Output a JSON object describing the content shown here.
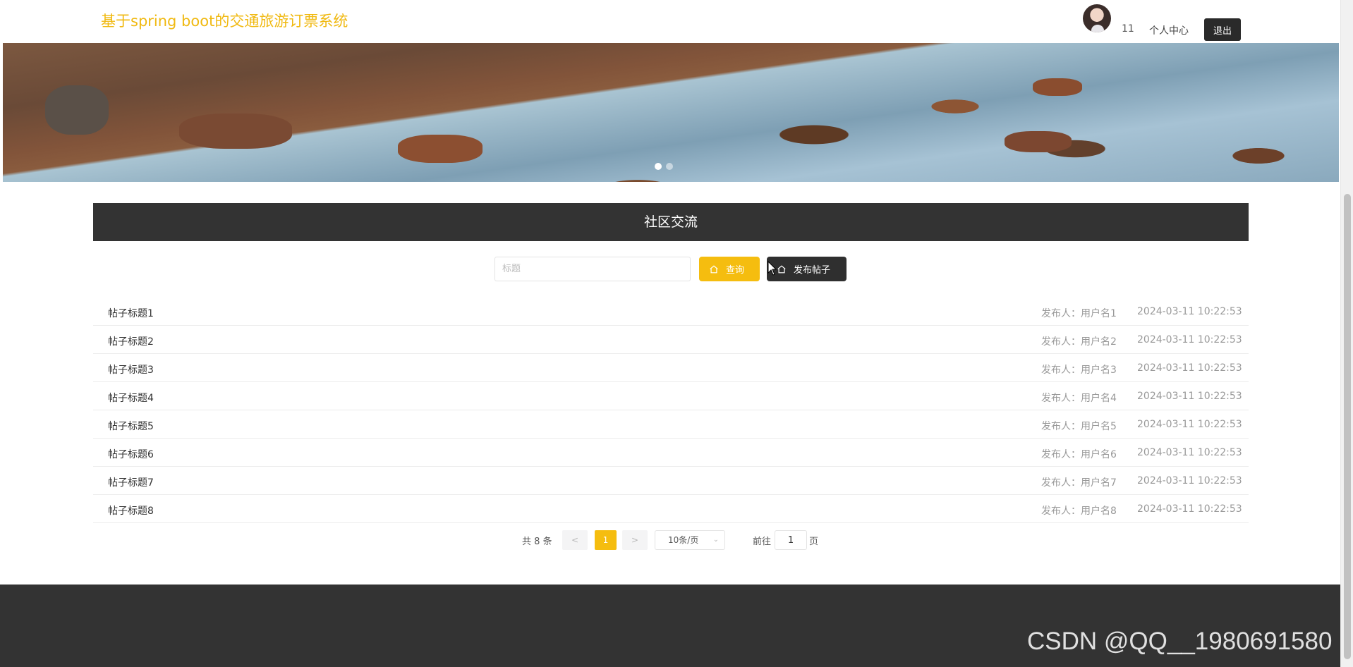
{
  "header": {
    "site_title": "基于spring boot的交通旅游订票系统",
    "username": "11",
    "profile_link": "个人中心",
    "logout_label": "退出"
  },
  "banner": {
    "slide_count": 2,
    "active_slide": 1
  },
  "section": {
    "title": "社区交流"
  },
  "search": {
    "placeholder": "标题",
    "value": "",
    "search_label": "查询",
    "post_label": "发布帖子",
    "search_icon": "home-icon",
    "post_icon": "home-icon"
  },
  "posts": [
    {
      "title": "帖子标题1",
      "author": "发布人：用户名1",
      "time": "2024-03-11 10:22:53"
    },
    {
      "title": "帖子标题2",
      "author": "发布人：用户名2",
      "time": "2024-03-11 10:22:53"
    },
    {
      "title": "帖子标题3",
      "author": "发布人：用户名3",
      "time": "2024-03-11 10:22:53"
    },
    {
      "title": "帖子标题4",
      "author": "发布人：用户名4",
      "time": "2024-03-11 10:22:53"
    },
    {
      "title": "帖子标题5",
      "author": "发布人：用户名5",
      "time": "2024-03-11 10:22:53"
    },
    {
      "title": "帖子标题6",
      "author": "发布人：用户名6",
      "time": "2024-03-11 10:22:53"
    },
    {
      "title": "帖子标题7",
      "author": "发布人：用户名7",
      "time": "2024-03-11 10:22:53"
    },
    {
      "title": "帖子标题8",
      "author": "发布人：用户名8",
      "time": "2024-03-11 10:22:53"
    }
  ],
  "pagination": {
    "total": "共 8 条",
    "prev": "<",
    "current_page": "1",
    "next": ">",
    "page_size": "10条/页",
    "goto_label": "前往",
    "goto_value": "1",
    "goto_suffix": "页"
  },
  "watermark": "CSDN @QQ__1980691580",
  "colors": {
    "accent": "#f5bd0f",
    "title": "#f0b911",
    "dark": "#333333"
  }
}
